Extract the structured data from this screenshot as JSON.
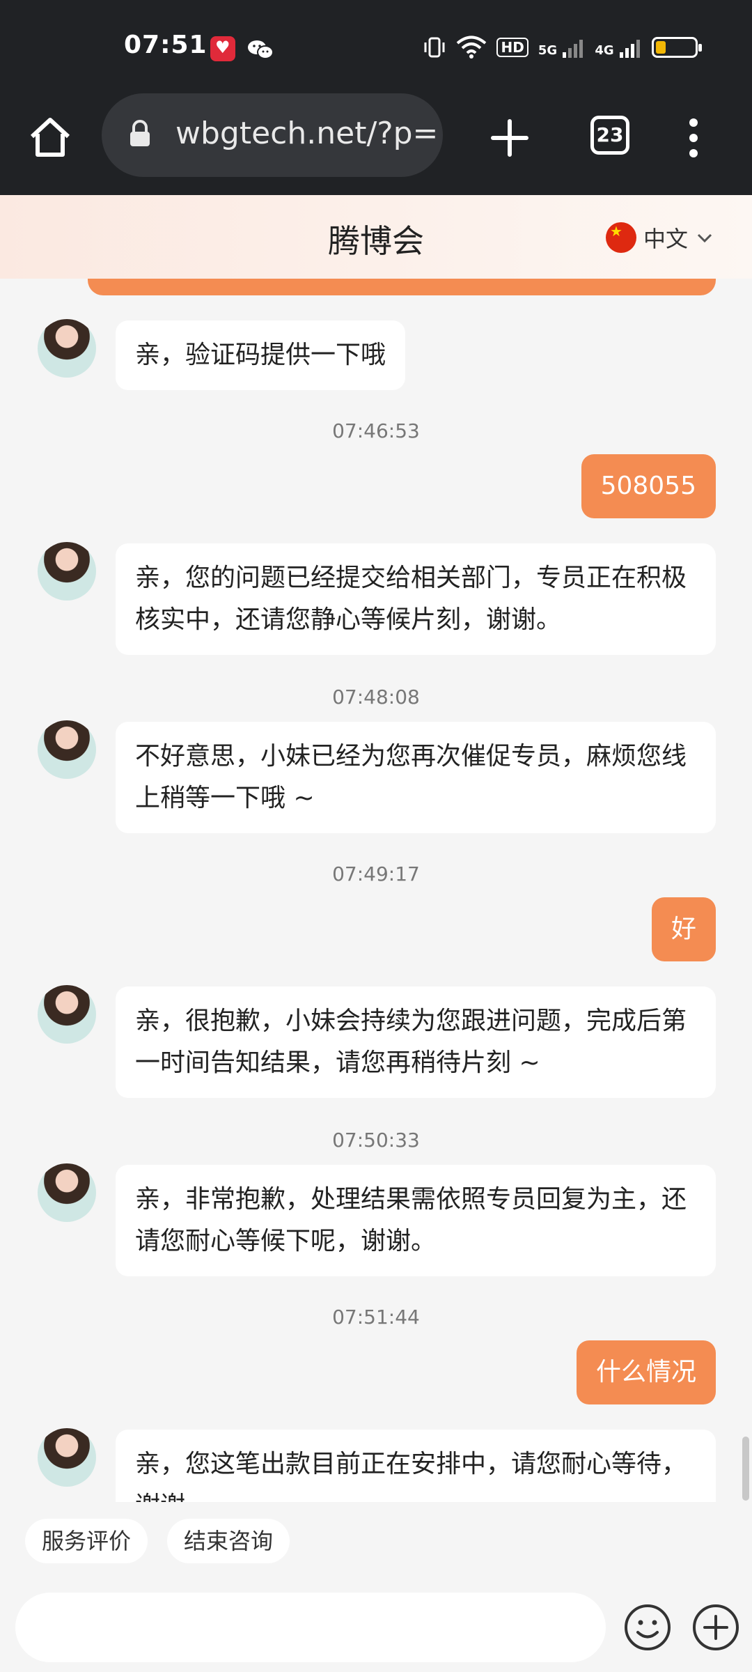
{
  "status_bar": {
    "time": "07:51",
    "network": [
      "5G",
      "4G"
    ],
    "hd_label": "HD",
    "battery_level": 0.25,
    "battery_color": "#f2b705"
  },
  "browser": {
    "url": "wbgtech.net/?p=",
    "tab_count": "23",
    "icons": [
      "home-icon",
      "lock-icon",
      "plus-icon",
      "tabs-icon",
      "menu-icon"
    ]
  },
  "header": {
    "title": "腾博会",
    "language": "中文",
    "accent_color": "#f48c52"
  },
  "messages": [
    {
      "type": "in",
      "text": "亲，验证码提供一下哦"
    },
    {
      "type": "time",
      "text": "07:46:53"
    },
    {
      "type": "out",
      "text": "508055"
    },
    {
      "type": "in",
      "text": "亲，您的问题已经提交给相关部门，专员正在积极核实中，还请您静心等候片刻，谢谢。"
    },
    {
      "type": "time",
      "text": "07:48:08"
    },
    {
      "type": "in",
      "text": "不好意思，小妹已经为您再次催促专员，麻烦您线上稍等一下哦 ~"
    },
    {
      "type": "time",
      "text": "07:49:17"
    },
    {
      "type": "out",
      "text": "好"
    },
    {
      "type": "in",
      "text": "亲，很抱歉，小妹会持续为您跟进问题，完成后第一时间告知结果，请您再稍待片刻 ~"
    },
    {
      "type": "time",
      "text": "07:50:33"
    },
    {
      "type": "in",
      "text": "亲，非常抱歉，处理结果需依照专员回复为主，还请您耐心等候下呢，谢谢。"
    },
    {
      "type": "time",
      "text": "07:51:44"
    },
    {
      "type": "out",
      "text": "什么情况"
    },
    {
      "type": "in",
      "text": "亲，您这笔出款目前正在安排中，请您耐心等待，谢谢。"
    }
  ],
  "quick_actions": {
    "rate": "服务评价",
    "end": "结束咨询"
  },
  "input": {
    "placeholder": ""
  }
}
